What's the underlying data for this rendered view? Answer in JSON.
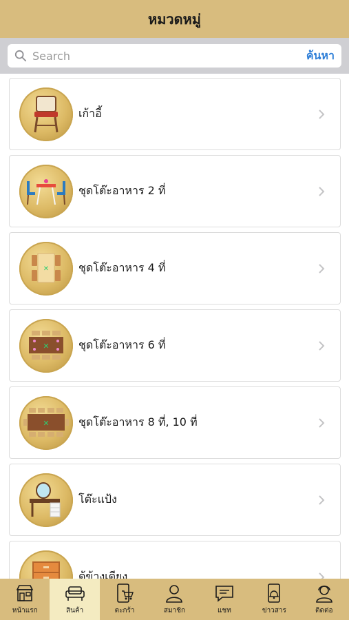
{
  "header": {
    "title": "หมวดหมู่"
  },
  "search": {
    "placeholder": "Search",
    "value": "",
    "button_label": "ค้นหา"
  },
  "categories": [
    {
      "label": "เก้าอี้",
      "icon": "chair-icon"
    },
    {
      "label": "ชุดโต๊ะอาหาร 2 ที่",
      "icon": "dining-set-2-icon"
    },
    {
      "label": "ชุดโต๊ะอาหาร 4 ที่",
      "icon": "dining-set-4-icon"
    },
    {
      "label": "ชุดโต๊ะอาหาร 6 ที่",
      "icon": "dining-set-6-icon"
    },
    {
      "label": "ชุดโต๊ะอาหาร 8 ที่, 10 ที่",
      "icon": "dining-set-8-icon"
    },
    {
      "label": "โต๊ะแป้ง",
      "icon": "dressing-table-icon"
    },
    {
      "label": "ตู้ข้างเตียง",
      "icon": "bedside-cabinet-icon"
    }
  ],
  "tabs": [
    {
      "label": "หน้าแรก",
      "icon": "store-icon",
      "active": false
    },
    {
      "label": "สินค้า",
      "icon": "sofa-icon",
      "active": true
    },
    {
      "label": "ตะกร้า",
      "icon": "cart-icon",
      "active": false
    },
    {
      "label": "สมาชิก",
      "icon": "member-icon",
      "active": false
    },
    {
      "label": "แชท",
      "icon": "chat-icon",
      "active": false
    },
    {
      "label": "ข่าวสาร",
      "icon": "news-icon",
      "active": false
    },
    {
      "label": "ติดต่อ",
      "icon": "contact-icon",
      "active": false
    }
  ],
  "colors": {
    "header_bg": "#d8bc7e",
    "active_tab_bg": "#f4ebc1",
    "link_blue": "#2f7fd8"
  }
}
